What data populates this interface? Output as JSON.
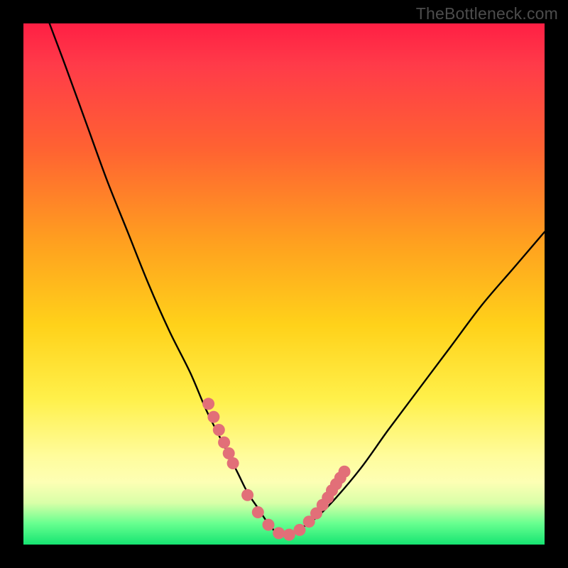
{
  "watermark": "TheBottleneck.com",
  "colors": {
    "background": "#000000",
    "gradient_top": "#ff1f44",
    "gradient_mid": "#ffd21a",
    "gradient_bottom": "#16e472",
    "curve": "#000000",
    "dot": "#e26f78"
  },
  "chart_data": {
    "type": "line",
    "title": "",
    "xlabel": "",
    "ylabel": "",
    "xlim": [
      0,
      100
    ],
    "ylim": [
      0,
      100
    ],
    "note": "Axes unlabeled in image; x/y in percent of plot area, y=0 at bottom (green band).",
    "series": [
      {
        "name": "bottleneck-curve",
        "x": [
          5,
          8,
          12,
          16,
          20,
          24,
          28,
          32,
          35,
          38,
          41,
          43,
          45,
          47,
          49,
          51,
          53,
          56,
          60,
          65,
          70,
          76,
          82,
          88,
          94,
          100
        ],
        "y": [
          100,
          92,
          81,
          70,
          60,
          50,
          41,
          33,
          26,
          20,
          14,
          10,
          7,
          4,
          2,
          2,
          3,
          5,
          9,
          15,
          22,
          30,
          38,
          46,
          53,
          60
        ]
      }
    ],
    "points": {
      "name": "highlight-dots",
      "note": "Pink dots near the valley of the curve",
      "x": [
        35.5,
        36.5,
        37.5,
        38.5,
        39.4,
        40.2,
        43.0,
        45.0,
        47.0,
        49.0,
        51.0,
        53.0,
        54.8,
        56.2,
        57.4,
        58.4,
        59.2,
        60.0,
        60.8,
        61.6
      ],
      "y": [
        27.0,
        24.5,
        22.0,
        19.6,
        17.5,
        15.6,
        9.5,
        6.2,
        3.8,
        2.2,
        1.9,
        2.8,
        4.4,
        6.0,
        7.6,
        9.0,
        10.4,
        11.6,
        12.8,
        14.0
      ]
    }
  }
}
